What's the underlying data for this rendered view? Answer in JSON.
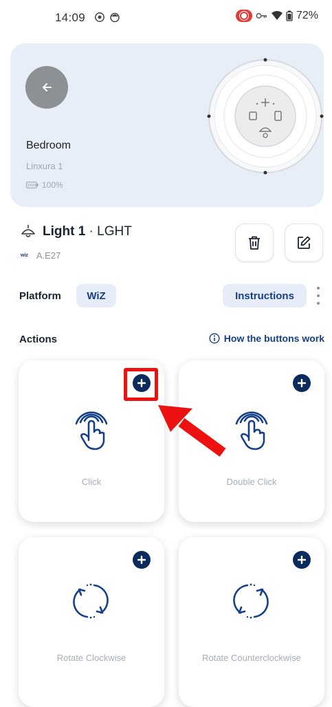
{
  "status_bar": {
    "time": "14:09",
    "battery": "72%",
    "icons": [
      "record-icon",
      "face-icon",
      "screen-record-icon",
      "key-icon",
      "wifi-icon",
      "battery-icon"
    ]
  },
  "device": {
    "name": "Bedroom",
    "model": "Linxura 1",
    "battery": "100%",
    "back_icon": "arrow-left-icon"
  },
  "light": {
    "name": "Light 1",
    "separator": " · ",
    "code": "LGHT",
    "platform_mini": "wiz",
    "bulb_type": "A.E27",
    "delete_icon": "trash-icon",
    "edit_icon": "edit-icon"
  },
  "platform": {
    "label": "Platform",
    "value": "WiZ",
    "instructions_label": "Instructions"
  },
  "actions": {
    "label": "Actions",
    "help_link": "How the buttons work",
    "items": [
      {
        "label": "Click",
        "icon": "tap-icon"
      },
      {
        "label": "Double Click",
        "icon": "tap-icon"
      },
      {
        "label": "Rotate Clockwise",
        "icon": "rotate-clockwise-icon"
      },
      {
        "label": "Rotate Counterclockwise",
        "icon": "rotate-counterclockwise-icon"
      }
    ]
  },
  "colors": {
    "accent": "#0b2a5e",
    "chip_bg": "#e6edf8",
    "card_bg": "#e8eef8",
    "highlight": "#ee1111"
  }
}
